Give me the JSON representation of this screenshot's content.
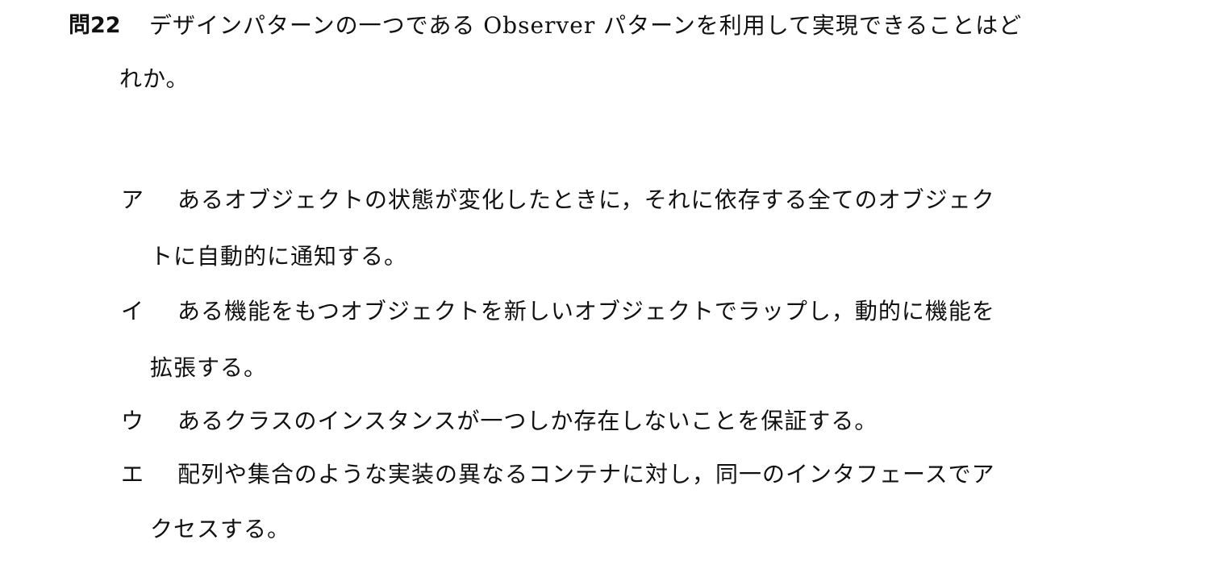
{
  "question": {
    "number": "問22",
    "text_line1": "デザインパターンの一つである Observer パターンを利用して実現できることはど",
    "text_line2": "れか。"
  },
  "choices": [
    {
      "mark": "ア",
      "line1": "あるオブジェクトの状態が変化したときに，それに依存する全てのオブジェク",
      "line2": "トに自動的に通知する。"
    },
    {
      "mark": "イ",
      "line1": "ある機能をもつオブジェクトを新しいオブジェクトでラップし，動的に機能を",
      "line2": "拡張する。"
    },
    {
      "mark": "ウ",
      "line1": "あるクラスのインスタンスが一つしか存在しないことを保証する。",
      "line2": ""
    },
    {
      "mark": "エ",
      "line1": "配列や集合のような実装の異なるコンテナに対し，同一のインタフェースでア",
      "line2": "クセスする。"
    }
  ]
}
